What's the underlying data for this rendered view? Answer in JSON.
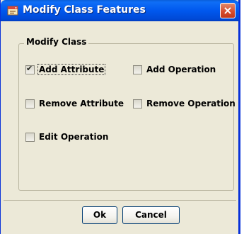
{
  "window": {
    "title": "Modify Class Features",
    "close_glyph": "×",
    "icon": "app-icon"
  },
  "group": {
    "label": "Modify Class",
    "options": [
      {
        "label": "Add Attribute",
        "checked": true,
        "focused": true
      },
      {
        "label": "Add Operation",
        "checked": false
      },
      {
        "label": "Remove Attribute",
        "checked": false
      },
      {
        "label": "Remove Operation",
        "checked": false
      },
      {
        "label": "Edit Operation",
        "checked": false
      }
    ]
  },
  "buttons": {
    "ok": "Ok",
    "cancel": "Cancel"
  },
  "colors": {
    "title_bar": "#0058ee",
    "dialog_bg": "#ece9d8",
    "close_button": "#d74a2a"
  }
}
